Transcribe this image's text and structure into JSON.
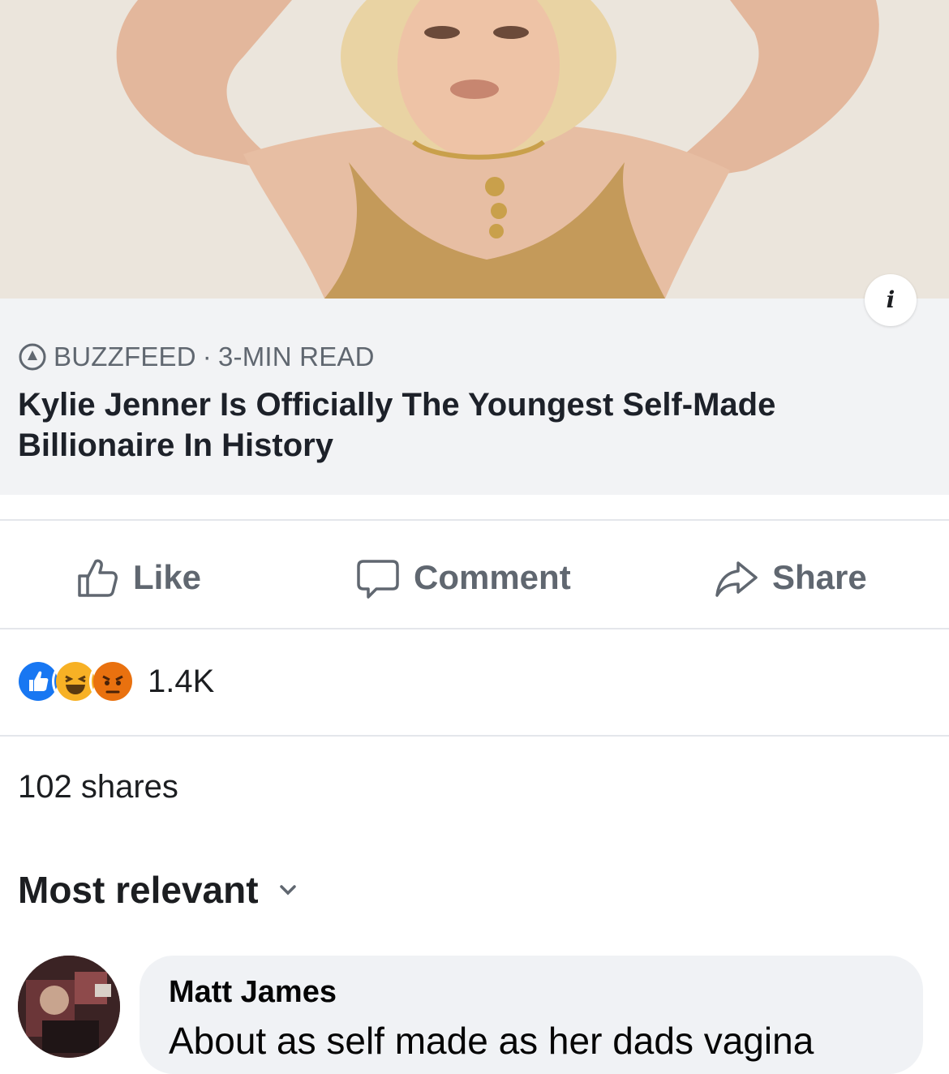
{
  "post": {
    "link_preview": {
      "source": "BUZZFEED",
      "separator": " · ",
      "read_time": "3-MIN READ",
      "headline": "Kylie Jenner Is Officially The Youngest Self-Made Billionaire In History",
      "info_label": "i"
    },
    "actions": {
      "like": "Like",
      "comment": "Comment",
      "share": "Share"
    },
    "reactions": {
      "types": [
        "like",
        "haha",
        "angry"
      ],
      "count": "1.4K"
    },
    "shares": "102 shares",
    "sort": {
      "label": "Most relevant"
    }
  },
  "comments": [
    {
      "author": "Matt James",
      "text": "About as self made as her dads vagina"
    }
  ],
  "colors": {
    "like_blue": "#1877f2",
    "haha_yellow": "#f7b125",
    "angry_orange": "#e9710f",
    "muted_text": "#606770",
    "preview_bg": "#f2f3f5"
  }
}
